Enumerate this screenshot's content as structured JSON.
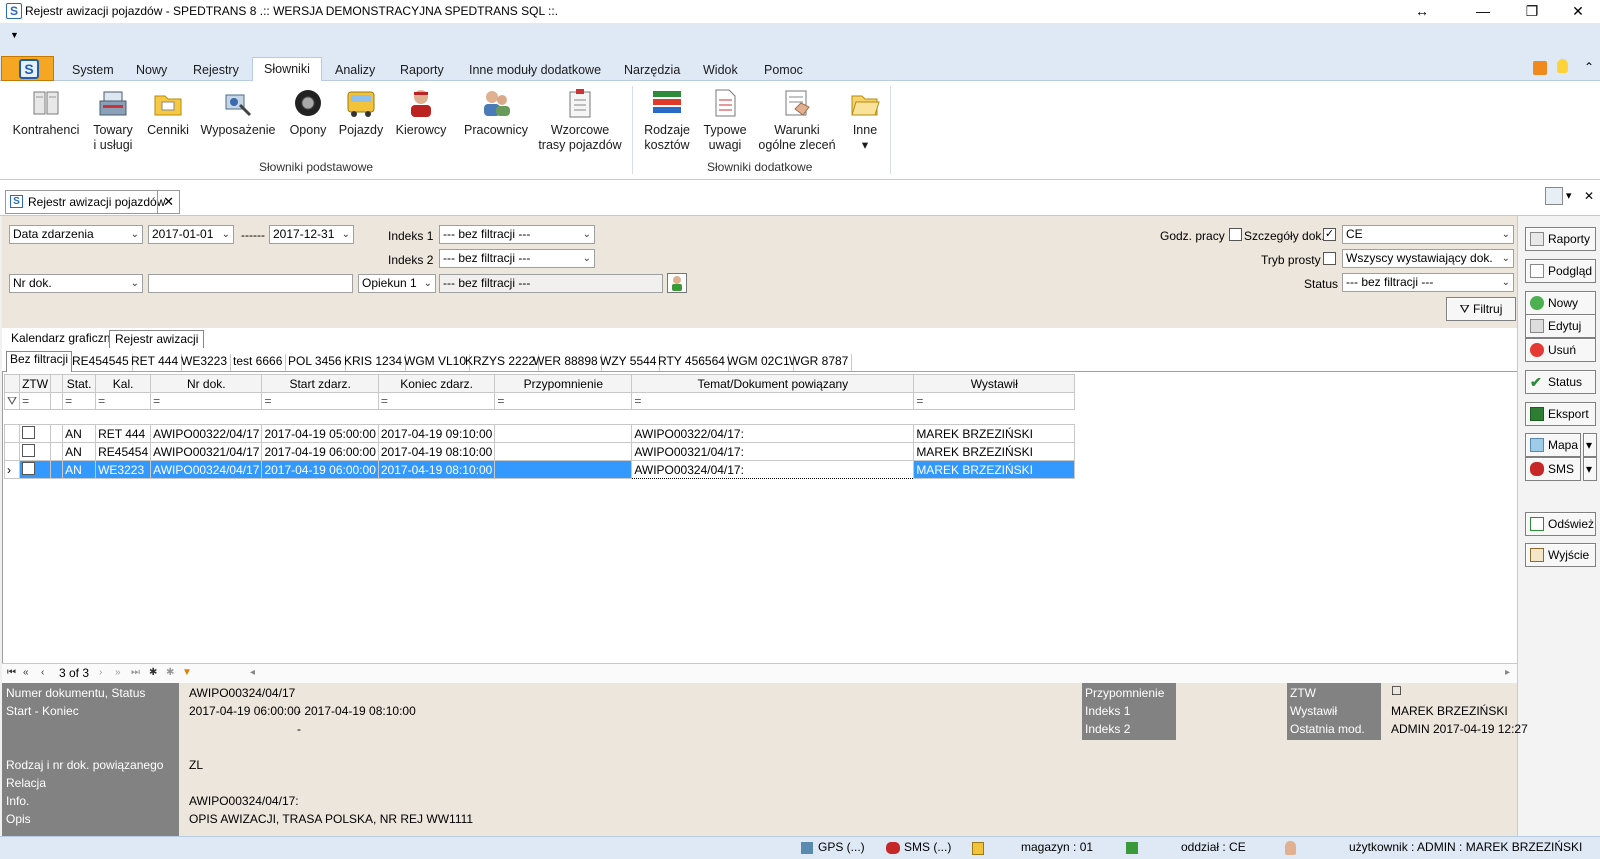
{
  "window": {
    "title": "Rejestr awizacji pojazdów - SPEDTRANS 8 .:: WERSJA DEMONSTRACYJNA SPEDTRANS SQL ::.",
    "app_logo": "S",
    "resize_glyph": "↔",
    "minimize_glyph": "—",
    "restore_glyph": "❐",
    "close_glyph": "✕"
  },
  "qat": {
    "dropdown_glyph": "▼"
  },
  "ribbon": {
    "tabs": [
      "System",
      "Nowy",
      "Rejestry",
      "Słowniki",
      "Analizy",
      "Raporty",
      "Inne moduły dodatkowe",
      "Narzędzia",
      "Widok",
      "Pomoc"
    ],
    "active_tab": "Słowniki",
    "group_basic": "Słowniki podstawowe",
    "group_extra": "Słowniki dodatkowe",
    "buttons": {
      "kontrahenci": "Kontrahenci",
      "towary_1": "Towary",
      "towary_2": "i usługi",
      "cenniki": "Cenniki",
      "wyposazenie": "Wyposażenie",
      "opony": "Opony",
      "pojazdy": "Pojazdy",
      "kierowcy": "Kierowcy",
      "pracownicy": "Pracownicy",
      "wzorcowe_1": "Wzorcowe",
      "wzorcowe_2": "trasy pojazdów",
      "rodzaje_1": "Rodzaje",
      "rodzaje_2": "kosztów",
      "typowe_1": "Typowe",
      "typowe_2": "uwagi",
      "warunki_1": "Warunki",
      "warunki_2": "ogólne zleceń",
      "inne": "Inne",
      "inne_arrow": "▾"
    },
    "right_icons": [
      "rss-icon",
      "lightbulb-icon",
      "collapse-icon"
    ],
    "collapse_glyph": "⌃"
  },
  "document_tab": {
    "label": "Rejestr awizacji pojazdów",
    "close_glyph": "✕"
  },
  "doc_tools": {
    "dropdown": "▾",
    "close": "✕"
  },
  "filters": {
    "date_field": "Data zdarzenia",
    "date_from": "2017-01-01",
    "date_sep": "------",
    "date_to": "2017-12-31",
    "index1_label": "Indeks 1",
    "index1_value": "--- bez filtracji ---",
    "index2_label": "Indeks 2",
    "index2_value": "--- bez filtracji ---",
    "doc_field": "Nr dok.",
    "doc_value": "",
    "opiekun_field": "Opiekun 1",
    "opiekun_value": "--- bez filtracji ---",
    "godz_label": "Godz. pracy",
    "szczegoly_label": "Szczegóły dok.",
    "szczegoly_checked": "✓",
    "branch_value": "CE",
    "tryb_label": "Tryb prosty",
    "wystawiajacy_value": "Wszyscy wystawiający dok.",
    "status_label": "Status",
    "status_value": "--- bez filtracji ---",
    "filter_button": "Filtruj",
    "dropdown_glyph": "⌄"
  },
  "view_tabs": [
    "Kalendarz graficzny",
    "Rejestr awizacji"
  ],
  "filter_tabs": [
    "Bez filtracji",
    "RE454545",
    "RET 444",
    "WE3223",
    "test 6666",
    "POL 3456",
    "KRIS 1234",
    "WGM VL10",
    "KRZYS 2222",
    "WER 88898",
    "WZY 5544",
    "RTY 456564",
    "WGM 02C1",
    "WGR 8787"
  ],
  "grid": {
    "columns": [
      "",
      "ZTW",
      "",
      "Stat.",
      "Kal.",
      "Nr dok.",
      "Start zdarz.",
      "Koniec zdarz.",
      "Przypomnienie",
      "Temat/Dokument powiązany",
      "Wystawił"
    ],
    "filter_glyph": "=",
    "rows": [
      {
        "stat": "AN",
        "kal": "RET 444",
        "nr": "AWIPO00322/04/17",
        "start": "2017-04-19 05:00:00",
        "end": "2017-04-19 09:10:00",
        "przyp": "",
        "temat": "AWIPO00322/04/17:",
        "wystawil": "MAREK BRZEZIŃSKI"
      },
      {
        "stat": "AN",
        "kal": "RE45454",
        "nr": "AWIPO00321/04/17",
        "start": "2017-04-19 06:00:00",
        "end": "2017-04-19 08:10:00",
        "przyp": "",
        "temat": "AWIPO00321/04/17:",
        "wystawil": "MAREK BRZEZIŃSKI"
      },
      {
        "stat": "AN",
        "kal": "WE3223",
        "nr": "AWIPO00324/04/17",
        "start": "2017-04-19 06:00:00",
        "end": "2017-04-19 08:10:00",
        "przyp": "",
        "temat": "AWIPO00324/04/17:",
        "wystawil": "MAREK BRZEZIŃSKI"
      }
    ],
    "selected_row": 3,
    "row_pointer": "›"
  },
  "navigator": {
    "first": "⏮",
    "prev_page": "«",
    "prev": "‹",
    "position": "3 of 3",
    "next": "›",
    "next_page": "»",
    "last": "⏭",
    "add": "✱",
    "filter": "▼",
    "scroll_left": "◂",
    "scroll_right": "▸"
  },
  "detail": {
    "numer_label": "Numer dokumentu, Status",
    "numer_value": "AWIPO00324/04/17",
    "startkoniec_label": "Start - Koniec",
    "start_value": "2017-04-19 06:00:00",
    "end_value": "- 2017-04-19 08:10:00",
    "dash": "-",
    "rodzaj_label": "Rodzaj i nr dok. powiązanego",
    "rodzaj_value": "ZL",
    "relacja_label": "Relacja",
    "info_label": "Info.",
    "info_value": "AWIPO00324/04/17:",
    "opis_label": "Opis",
    "opis_value": "OPIS AWIZACJI, TRASA POLSKA, NR REJ WW1111",
    "przyp_label": "Przypomnienie",
    "idx1_label": "Indeks 1",
    "idx2_label": "Indeks 2",
    "ztw_label": "ZTW",
    "ztw_value": "☐",
    "wystawil_label": "Wystawił",
    "wystawil_value": "MAREK BRZEZIŃSKI",
    "ostatnia_label": "Ostatnia mod.",
    "ostatnia_value": "ADMIN 2017-04-19 12:27"
  },
  "side_buttons": {
    "raporty": "Raporty",
    "podglad": "Podgląd",
    "nowy": "Nowy",
    "edytuj": "Edytuj",
    "usun": "Usuń",
    "status": "Status",
    "eksport": "Eksport",
    "mapa": "Mapa",
    "sms": "SMS",
    "odswiez": "Odśwież",
    "wyjscie": "Wyjście",
    "split_arrow": "▾"
  },
  "statusbar": {
    "gps": "GPS (...)",
    "sms": "SMS (...)",
    "magazyn": "magazyn : 01",
    "oddzial": "oddział : CE",
    "uzytkownik": "użytkownik : ADMIN : MAREK BRZEZIŃSKI"
  }
}
